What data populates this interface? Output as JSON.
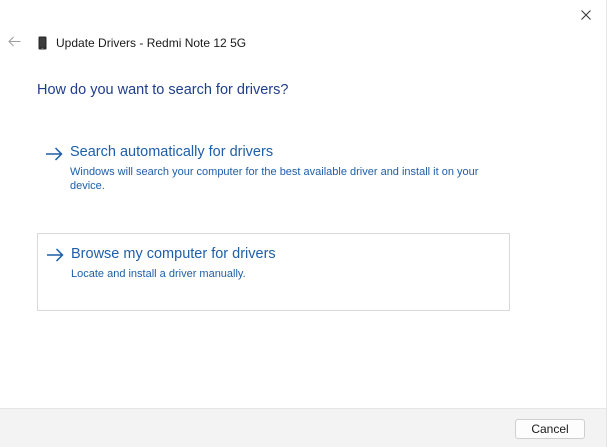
{
  "window": {
    "title": "Update Drivers - Redmi Note 12 5G",
    "close_icon": "close-icon",
    "back_icon": "back-arrow-icon",
    "device_icon": "phone-icon"
  },
  "heading": "How do you want to search for drivers?",
  "options": [
    {
      "title": "Search automatically for drivers",
      "description": "Windows will search your computer for the best available driver and install it on your device.",
      "icon": "arrow-right-icon"
    },
    {
      "title": "Browse my computer for drivers",
      "description": "Locate and install a driver manually.",
      "icon": "arrow-right-icon"
    }
  ],
  "footer": {
    "cancel_label": "Cancel"
  },
  "colors": {
    "heading": "#1f3e8a",
    "link": "#1f5ea8",
    "footer_bg": "#f3f3f3"
  }
}
